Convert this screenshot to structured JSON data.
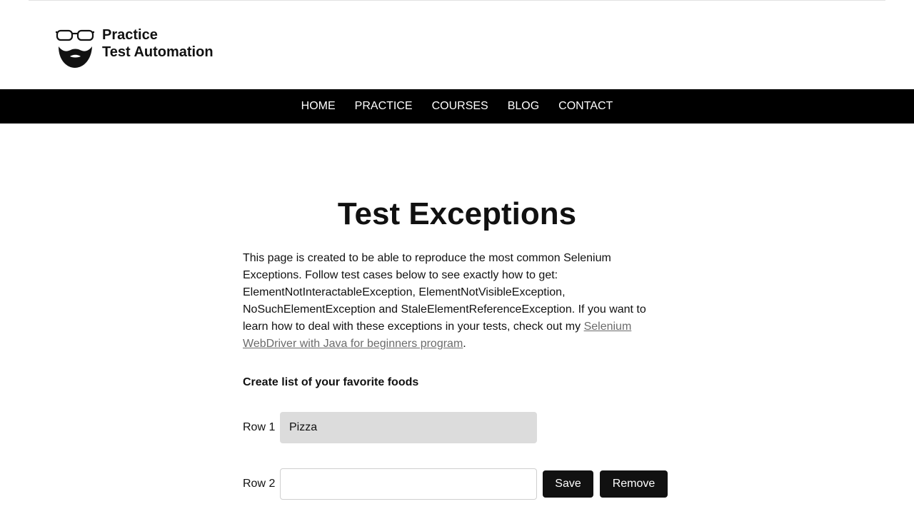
{
  "site": {
    "logo_line1": "Practice",
    "logo_line2": "Test Automation",
    "logo_icon": "glasses-beard-icon"
  },
  "nav": {
    "items": [
      "HOME",
      "PRACTICE",
      "COURSES",
      "BLOG",
      "CONTACT"
    ]
  },
  "page": {
    "title": "Test Exceptions",
    "intro_text": "This page is created to be able to reproduce the most common Selenium Exceptions. Follow test cases below to see exactly how to get: ElementNotInteractableException, ElementNotVisibleException, NoSuchElementException and StaleElementReferenceException. If you want to learn how to deal with these exceptions in your tests, check out my ",
    "intro_link": "Selenium WebDriver with Java for beginners program",
    "intro_end": ".",
    "section_heading": "Create list of your favorite foods"
  },
  "rows": [
    {
      "label": "Row 1",
      "value": "Pizza",
      "disabled": true
    },
    {
      "label": "Row 2",
      "value": "",
      "disabled": false
    }
  ],
  "buttons": {
    "save": "Save",
    "remove": "Remove"
  },
  "colors": {
    "navbar": "#000000",
    "button": "#111111",
    "disabled_input": "#dcdcdc",
    "link": "#6b6b6b"
  }
}
